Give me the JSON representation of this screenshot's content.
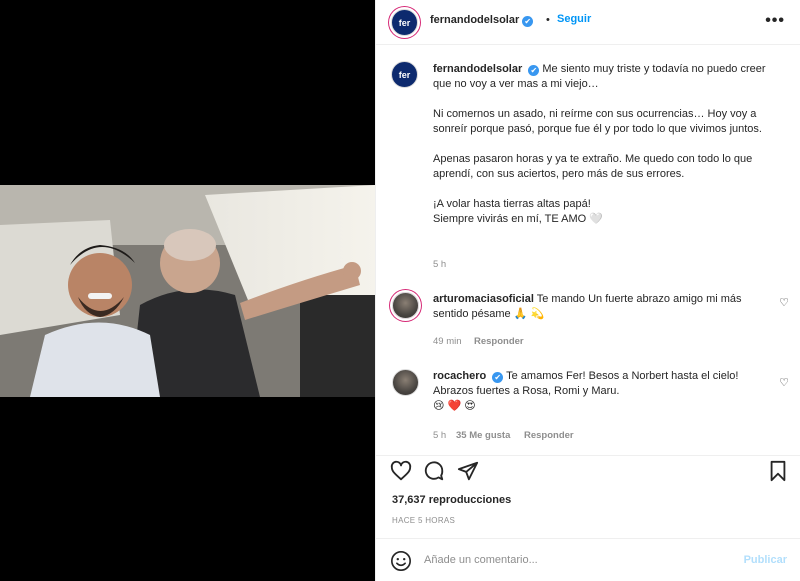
{
  "header": {
    "avatar_text": "fer",
    "username": "fernandodelsolar",
    "verified": "✔",
    "separator": "•",
    "follow_label": "Seguir",
    "more_label": "•••"
  },
  "caption": {
    "username": "fernandodelsolar",
    "paragraphs": [
      "Me siento muy triste y todavía no puedo creer que no voy a ver mas a mi viejo…",
      "Ni comernos un asado, ni reírme con sus ocurrencias… Hoy voy a sonreír porque pasó, porque fue él y por todo lo que vivimos juntos.",
      "Apenas pasaron horas y ya te extraño. Me quedo con todo lo que aprendí, con sus aciertos, pero más de sus errores.",
      "¡A volar hasta tierras altas papá!\nSiempre vivirás en mí, TE AMO 🤍"
    ],
    "age": "5 h"
  },
  "comments": [
    {
      "username": "arturomaciasoficial",
      "text": "Te mando Un fuerte abrazo amigo mi más sentido pésame 🙏 💫",
      "age": "49 min",
      "reply_label": "Responder"
    },
    {
      "username": "rocachero",
      "text": "Te amamos Fer! Besos a Norbert hasta el cielo! Abrazos fuertes a Rosa, Romi y Maru.",
      "emojis": "😢 ❤️ 😍",
      "age": "5 h",
      "likes": "35 Me gusta",
      "reply_label": "Responder"
    }
  ],
  "stats": {
    "views": "37,637 reproducciones",
    "time": "HACE 5 HORAS"
  },
  "composer": {
    "placeholder": "Añade un comentario...",
    "publish_label": "Publicar"
  },
  "colors": {
    "accent": "#0095f6",
    "verified": "#3897f0",
    "muted": "#8e8e8e",
    "publish_disabled": "#b2dffc"
  },
  "icons": [
    "heart-icon",
    "comment-icon",
    "share-icon",
    "bookmark-icon",
    "emoji-icon",
    "more-icon",
    "verified-icon"
  ]
}
